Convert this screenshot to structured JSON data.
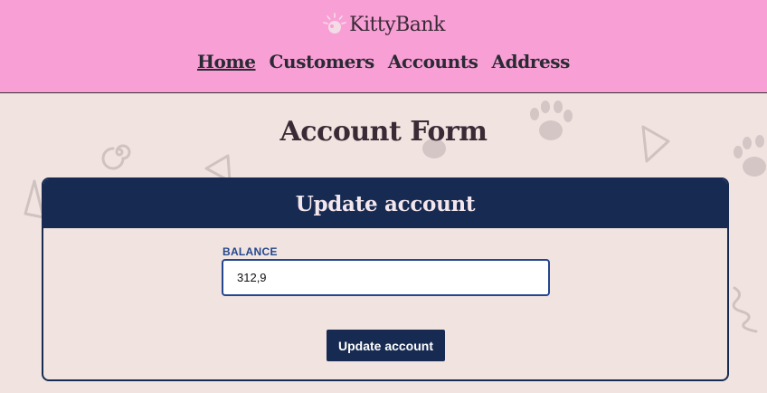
{
  "brand": {
    "name": "KittyBank",
    "logo_icon": "paw-sun-icon"
  },
  "nav": [
    {
      "label": "Home",
      "active": true
    },
    {
      "label": "Customers",
      "active": false
    },
    {
      "label": "Accounts",
      "active": false
    },
    {
      "label": "Address",
      "active": false
    }
  ],
  "page": {
    "title": "Account Form"
  },
  "form": {
    "heading": "Update account",
    "balance_label": "BALANCE",
    "balance_value": "312,9",
    "submit_label": "Update account"
  },
  "colors": {
    "header_bg": "#f8a0d6",
    "page_bg": "#f1e4e0",
    "navy": "#172b52",
    "label_blue": "#24468f"
  }
}
